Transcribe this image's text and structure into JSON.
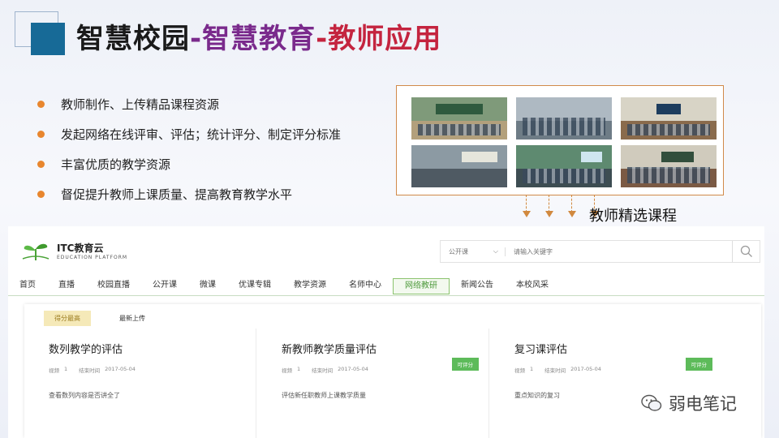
{
  "slide": {
    "title": {
      "part1": "智慧校园",
      "part2": "-智慧教育",
      "part3": "-教师应用"
    },
    "bullets": [
      "教师制作、上传精品课程资源",
      "发起网络在线评审、评估；统计评分、制定评分标准",
      "丰富优质的教学资源",
      "督促提升教师上课质量、提高教育教学水平"
    ],
    "course_label": "教师精选课程",
    "watermark": "弱电笔记",
    "colors": {
      "title_dark": "#1a1a1a",
      "title_purple": "#7a2a8c",
      "title_red": "#c4243f",
      "bullet_orange": "#e8862e",
      "accent_blue": "#176a97"
    }
  },
  "site": {
    "logo_name": "ITC教育云",
    "logo_sub": "EDUCATION  PLATFORM",
    "search": {
      "category": "公开课",
      "placeholder": "请输入关键字"
    },
    "nav": [
      "首页",
      "直播",
      "校园直播",
      "公开课",
      "微课",
      "优课专辑",
      "教学资源",
      "名师中心",
      "网络教研",
      "新闻公告",
      "本校风采"
    ],
    "nav_active": "网络教研",
    "tabs": [
      "得分最高",
      "最新上传"
    ],
    "tab_active": "得分最高",
    "cards": [
      {
        "title": "数列教学的评估",
        "video_label": "视频",
        "video_count": "1",
        "end_label": "结束时间",
        "end_date": "2017-05-04",
        "tag": "",
        "desc": "查看数列内容是否讲全了"
      },
      {
        "title": "新教师教学质量评估",
        "video_label": "视频",
        "video_count": "1",
        "end_label": "结束时间",
        "end_date": "2017-05-04",
        "tag": "可评分",
        "desc": "评估新任职教师上课教学质量"
      },
      {
        "title": "复习课评估",
        "video_label": "视频",
        "video_count": "1",
        "end_label": "结束时间",
        "end_date": "2017-05-04",
        "tag": "可评分",
        "desc": "重点知识的复习"
      }
    ]
  }
}
